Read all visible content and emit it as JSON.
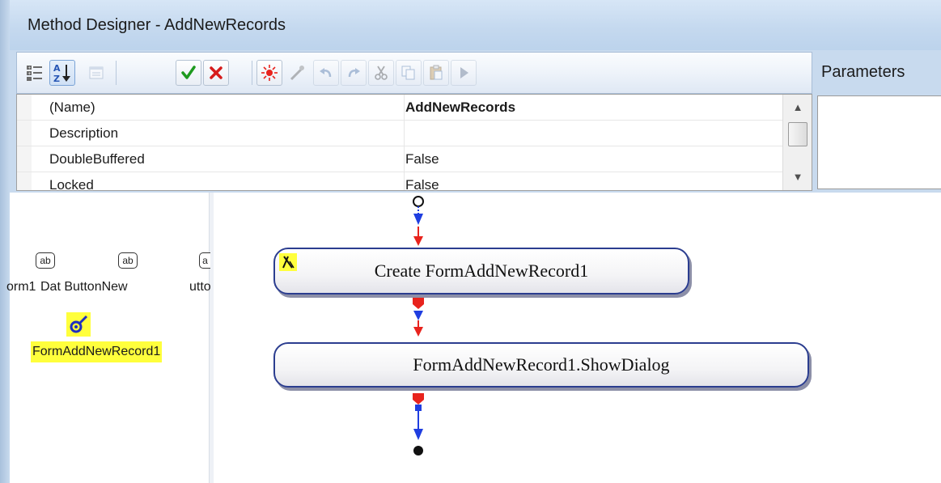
{
  "window": {
    "title": "Method Designer - AddNewRecords"
  },
  "toolbar": {
    "buttons": [
      {
        "name": "categorized-view-icon",
        "state": "enabled"
      },
      {
        "name": "alphabetical-sort-icon",
        "state": "active"
      },
      {
        "name": "property-pages-icon",
        "state": "disabled"
      },
      {
        "name": "accept-checkmark-icon",
        "state": "enabled"
      },
      {
        "name": "cancel-x-icon",
        "state": "enabled"
      },
      {
        "name": "action-sparkle-icon",
        "state": "enabled"
      },
      {
        "name": "magic-wand-icon",
        "state": "disabled"
      },
      {
        "name": "undo-icon",
        "state": "disabled"
      },
      {
        "name": "redo-icon",
        "state": "disabled"
      },
      {
        "name": "cut-icon",
        "state": "disabled"
      },
      {
        "name": "copy-icon",
        "state": "disabled"
      },
      {
        "name": "paste-icon",
        "state": "disabled"
      },
      {
        "name": "run-icon",
        "state": "disabled"
      }
    ]
  },
  "properties": {
    "rows": [
      {
        "name": "(Name)",
        "value": "AddNewRecords",
        "bold": true
      },
      {
        "name": "Description",
        "value": "",
        "bold": false
      },
      {
        "name": "DoubleBuffered",
        "value": "False",
        "bold": false
      },
      {
        "name": "Locked",
        "value": "False",
        "bold": false
      }
    ]
  },
  "parameters": {
    "label": "Parameters"
  },
  "components": {
    "items": [
      {
        "icon_text": "ab",
        "label": "orm1"
      },
      {
        "icon_text": "ab",
        "label": "Dat ButtonNew"
      },
      {
        "icon_text": "a",
        "label": "utto"
      }
    ],
    "selected": {
      "label": "FormAddNewRecord1",
      "icon": "form-wrench-icon"
    }
  },
  "flow": {
    "nodes": [
      {
        "label": "Create FormAddNewRecord1",
        "badge_icon": "create-action-icon"
      },
      {
        "label": "FormAddNewRecord1.ShowDialog"
      }
    ]
  },
  "colors": {
    "flow_arrow_red": "#e8231d",
    "flow_arrow_blue": "#1f3ee0",
    "selection_yellow": "#ffff3c",
    "node_border": "#2b3d8f"
  }
}
